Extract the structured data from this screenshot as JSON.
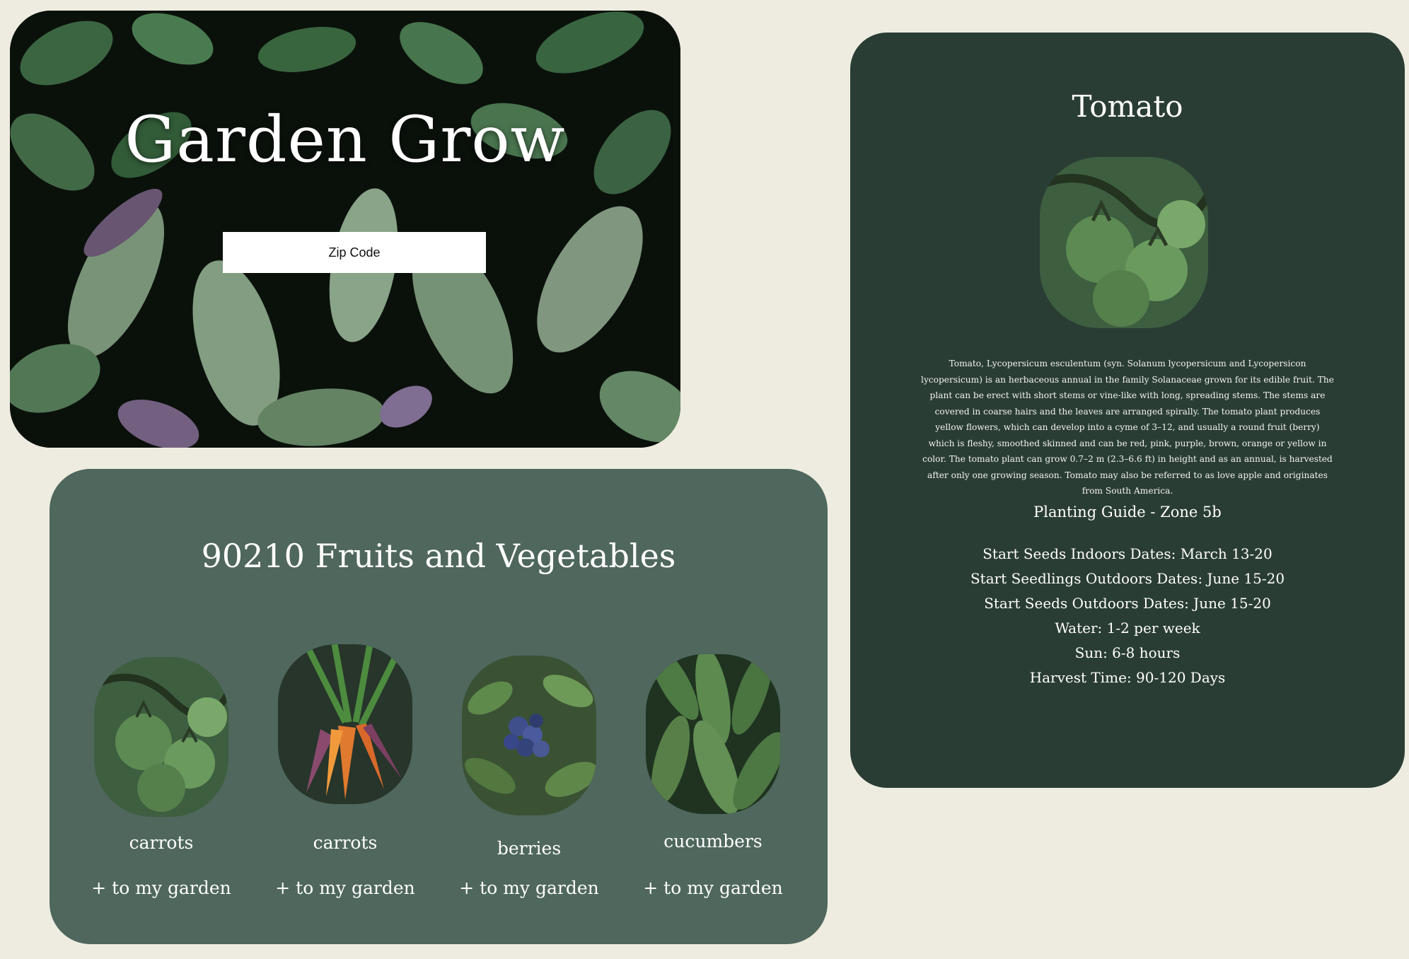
{
  "hero": {
    "title": "Garden Grow",
    "zip_placeholder": "Zip Code"
  },
  "fruits": {
    "title": "90210 Fruits and Vegetables",
    "items": [
      {
        "name": "carrots",
        "add": "+ to my garden",
        "image_icon": "tomato-photo"
      },
      {
        "name": "carrots",
        "add": "+ to my garden",
        "image_icon": "carrot-photo"
      },
      {
        "name": "berries",
        "add": "+ to my garden",
        "image_icon": "blueberry-photo"
      },
      {
        "name": "cucumbers",
        "add": "+ to my garden",
        "image_icon": "cucumber-photo"
      }
    ]
  },
  "detail": {
    "title": "Tomato",
    "image_icon": "tomato-photo",
    "description": "Tomato, Lycopersicum esculentum (syn. Solanum lycopersicum and Lycopersicon lycopersicum) is an herbaceous annual in the family Solanaceae grown for its edible fruit. The plant can be erect with short stems or vine-like with long, spreading stems. The stems are covered in coarse hairs and the leaves are arranged spirally. The tomato plant produces yellow flowers, which can develop into a cyme of 3–12, and usually a round fruit (berry) which is fleshy, smoothed skinned and can be red, pink, purple, brown, orange or yellow in color. The tomato plant can grow 0.7–2 m (2.3–6.6 ft) in height and as an annual, is harvested after only one growing season. Tomato may also be referred to as love apple and originates from South America.",
    "guide_title": "Planting Guide - Zone 5b",
    "guide": [
      "Start Seeds Indoors Dates: March 13-20",
      "Start Seedlings Outdoors Dates: June 15-20",
      "Start Seeds Outdoors Dates: June 15-20",
      "Water: 1-2 per week",
      "Sun: 6-8 hours",
      "Harvest Time: 90-120 Days"
    ]
  },
  "colors": {
    "page_background": "#eeece0",
    "fruits_card": "#4f675d",
    "detail_card": "#2a3d34",
    "text": "#ffffff"
  }
}
